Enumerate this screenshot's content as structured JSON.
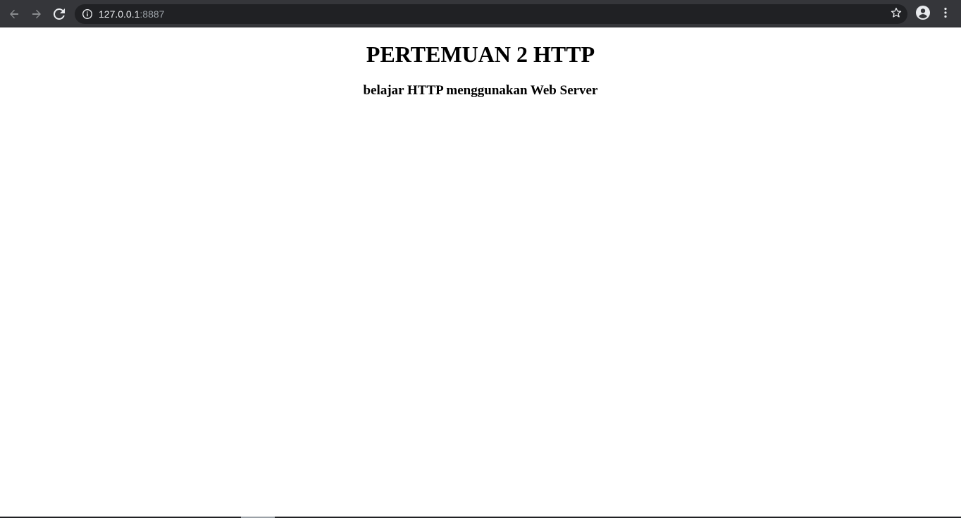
{
  "browser": {
    "url_host": "127.0.0.1",
    "url_port": ":8887",
    "icons": {
      "back": "arrow-left-icon",
      "forward": "arrow-right-icon",
      "reload": "reload-icon",
      "site_info": "info-icon",
      "bookmark": "star-icon",
      "profile": "account-circle-icon",
      "menu": "more-vertical-icon"
    },
    "colors": {
      "toolbar": "#35363a",
      "omnibox": "#202124",
      "icon_active": "#e8eaed",
      "icon_disabled": "#8a8c8f"
    }
  },
  "page": {
    "heading": "PERTEMUAN 2 HTTP",
    "subheading": "belajar HTTP menggunakan Web Server",
    "background": "#ffffff",
    "text_color": "#000000"
  }
}
